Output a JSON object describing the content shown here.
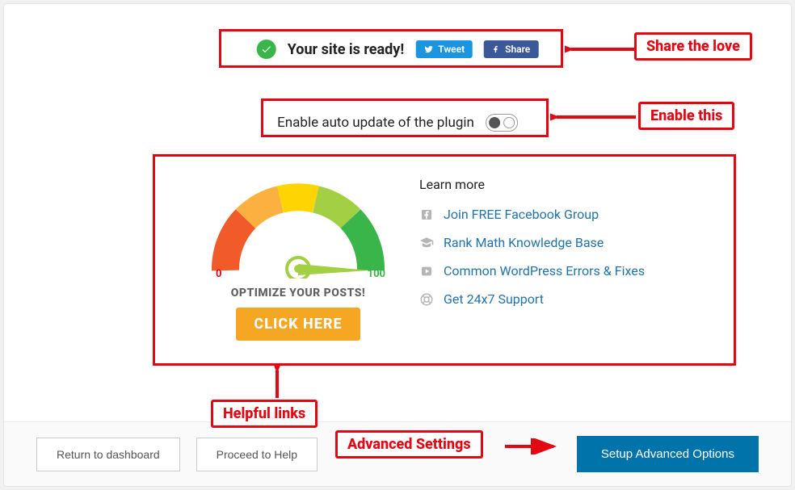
{
  "status": {
    "title": "Your site is ready!",
    "tweet_label": "Tweet",
    "share_label": "Share"
  },
  "auto_update": {
    "label": "Enable auto update of the plugin",
    "state": "off"
  },
  "gauge": {
    "min_label": "0",
    "max_label": "100",
    "optimize_text": "OPTIMIZE YOUR POSTS!",
    "cta_label": "CLICK HERE"
  },
  "learn_more": {
    "heading": "Learn more",
    "links": [
      {
        "icon": "facebook-icon",
        "label": "Join FREE Facebook Group"
      },
      {
        "icon": "graduation-cap-icon",
        "label": "Rank Math Knowledge Base"
      },
      {
        "icon": "play-icon",
        "label": "Common WordPress Errors & Fixes"
      },
      {
        "icon": "life-ring-icon",
        "label": "Get 24x7 Support"
      }
    ]
  },
  "footer": {
    "return_label": "Return to dashboard",
    "proceed_label": "Proceed to Help",
    "advanced_label": "Setup Advanced Options"
  },
  "annotations": {
    "share_love": "Share the love",
    "enable_this": "Enable this",
    "helpful_links": "Helpful links",
    "advanced_settings": "Advanced Settings"
  }
}
